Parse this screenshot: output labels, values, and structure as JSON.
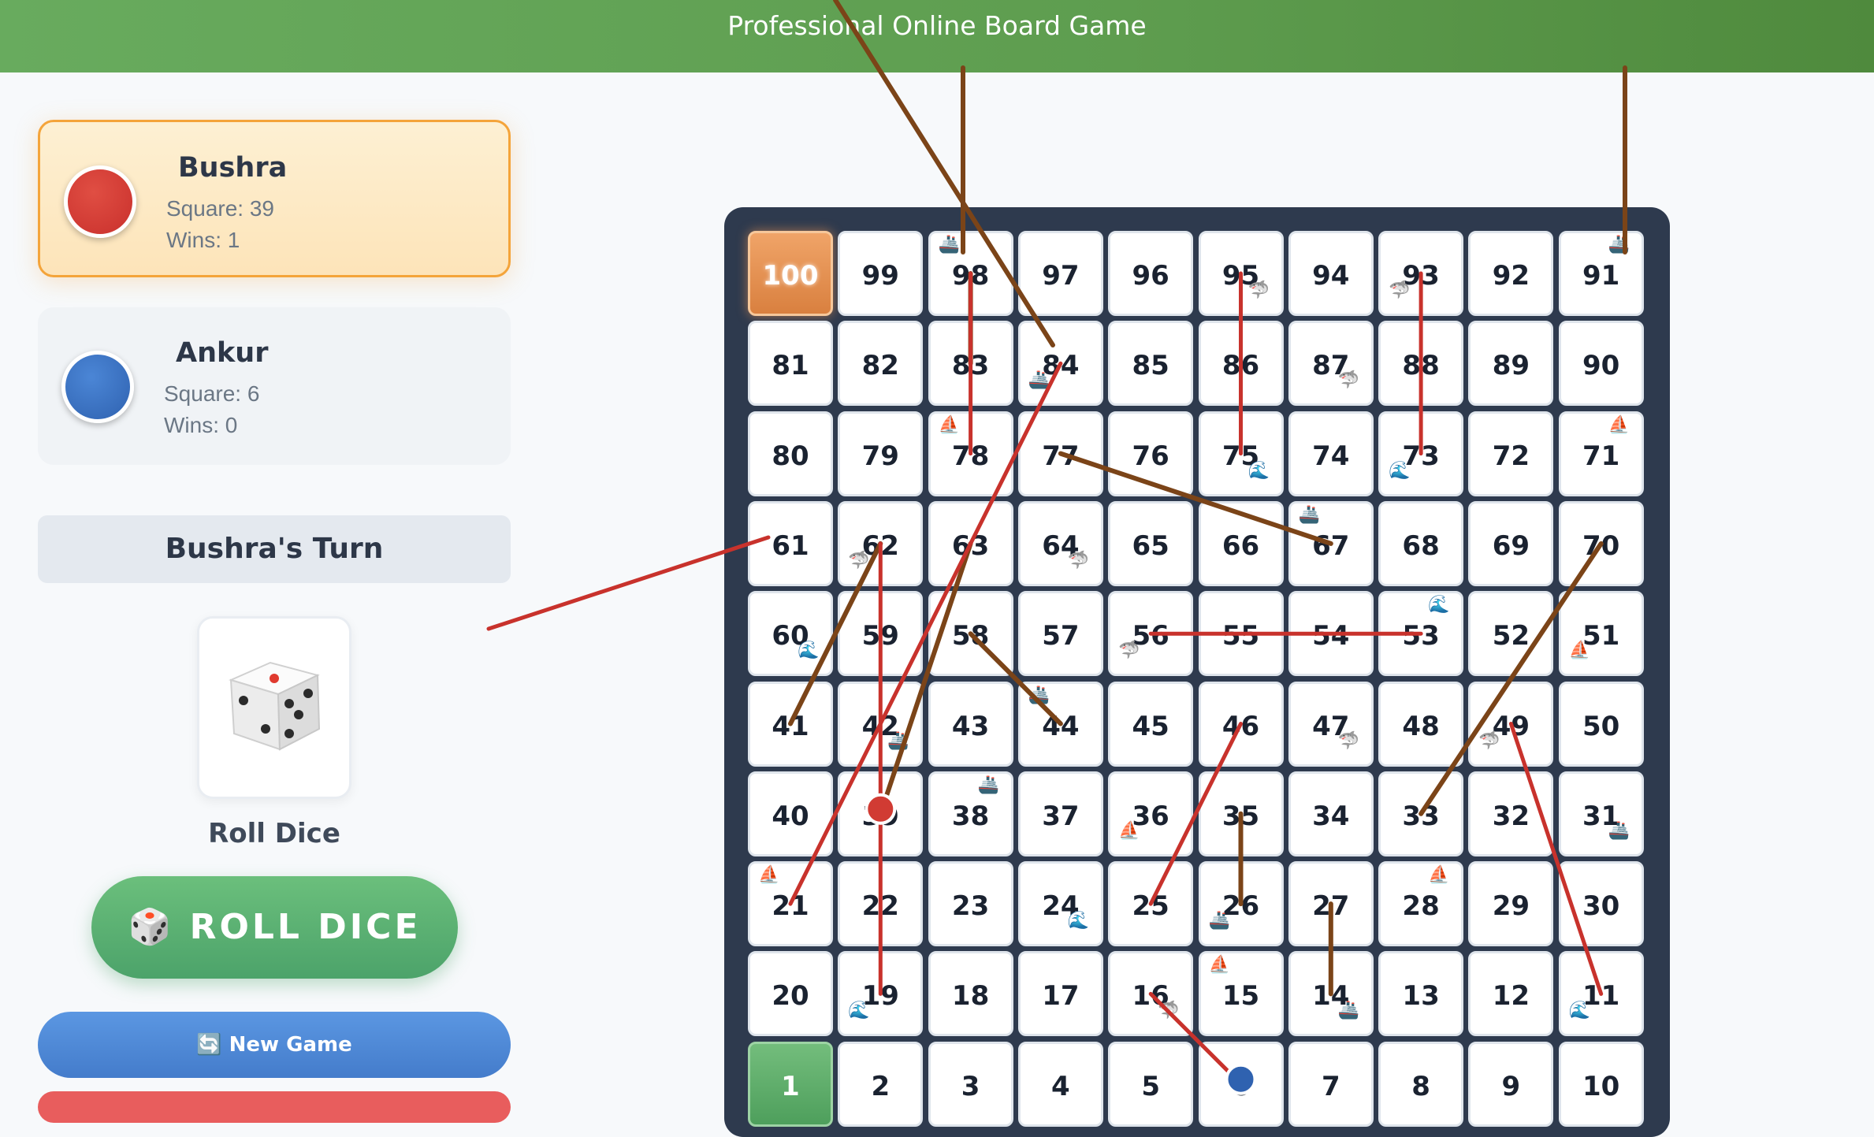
{
  "header": {
    "title": "Professional Online Board Game"
  },
  "players": [
    {
      "name": "Bushra",
      "square_text": "Square: 39",
      "wins_text": "Wins: 1",
      "color": "#d13b33",
      "active": true
    },
    {
      "name": "Ankur",
      "square_text": "Square: 6",
      "wins_text": "Wins: 0",
      "color": "#3a72c4",
      "active": false
    }
  ],
  "turn": {
    "label": "Bushra's Turn"
  },
  "dice": {
    "label": "Roll Dice",
    "face_icon": "die-five-icon"
  },
  "buttons": {
    "roll": "🎲 ROLL DICE",
    "new_game": "🔄 New Game"
  },
  "board": {
    "rows": [
      [
        100,
        99,
        98,
        97,
        96,
        95,
        94,
        93,
        92,
        91
      ],
      [
        81,
        82,
        83,
        84,
        85,
        86,
        87,
        88,
        89,
        90
      ],
      [
        80,
        79,
        78,
        77,
        76,
        75,
        74,
        73,
        72,
        71
      ],
      [
        61,
        62,
        63,
        64,
        65,
        66,
        67,
        68,
        69,
        70
      ],
      [
        60,
        59,
        58,
        57,
        56,
        55,
        54,
        53,
        52,
        51
      ],
      [
        41,
        42,
        43,
        44,
        45,
        46,
        47,
        48,
        49,
        50
      ],
      [
        40,
        39,
        38,
        37,
        36,
        35,
        34,
        33,
        32,
        31
      ],
      [
        21,
        22,
        23,
        24,
        25,
        26,
        27,
        28,
        29,
        30
      ],
      [
        20,
        19,
        18,
        17,
        16,
        15,
        14,
        13,
        12,
        11
      ],
      [
        1,
        2,
        3,
        4,
        5,
        6,
        7,
        8,
        9,
        10
      ]
    ],
    "finish_square": 100,
    "start_square": 1,
    "cell_icons": [
      {
        "square": 98,
        "icon": "🚢"
      },
      {
        "square": 95,
        "icon": "🦈"
      },
      {
        "square": 93,
        "icon": "🦈"
      },
      {
        "square": 91,
        "icon": "🚢"
      },
      {
        "square": 84,
        "icon": "🚢"
      },
      {
        "square": 87,
        "icon": "🦈"
      },
      {
        "square": 78,
        "icon": "⛵"
      },
      {
        "square": 75,
        "icon": "🌊"
      },
      {
        "square": 73,
        "icon": "🌊"
      },
      {
        "square": 71,
        "icon": "⛵"
      },
      {
        "square": 62,
        "icon": "🦈"
      },
      {
        "square": 64,
        "icon": "🦈"
      },
      {
        "square": 67,
        "icon": "🚢"
      },
      {
        "square": 60,
        "icon": "🌊"
      },
      {
        "square": 56,
        "icon": "🦈"
      },
      {
        "square": 53,
        "icon": "🌊"
      },
      {
        "square": 51,
        "icon": "⛵"
      },
      {
        "square": 42,
        "icon": "🚢"
      },
      {
        "square": 44,
        "icon": "🚢"
      },
      {
        "square": 47,
        "icon": "🦈"
      },
      {
        "square": 49,
        "icon": "🦈"
      },
      {
        "square": 38,
        "icon": "🚢"
      },
      {
        "square": 36,
        "icon": "⛵"
      },
      {
        "square": 31,
        "icon": "🚢"
      },
      {
        "square": 21,
        "icon": "⛵"
      },
      {
        "square": 24,
        "icon": "🌊"
      },
      {
        "square": 26,
        "icon": "🚢"
      },
      {
        "square": 28,
        "icon": "⛵"
      },
      {
        "square": 19,
        "icon": "🌊"
      },
      {
        "square": 16,
        "icon": "🦈"
      },
      {
        "square": 15,
        "icon": "⛵"
      },
      {
        "square": 14,
        "icon": "🚢"
      },
      {
        "square": 11,
        "icon": "🌊"
      }
    ],
    "ladders": [
      {
        "from": 26,
        "to": 35
      },
      {
        "from": 14,
        "to": 27
      },
      {
        "from": 44,
        "to": 58
      },
      {
        "from": 67,
        "to": 77
      },
      {
        "from": 41,
        "to": 62
      },
      {
        "from": 39,
        "to": 63
      },
      {
        "from": 33,
        "to": 70
      },
      {
        "from": 83,
        "to": 98
      }
    ],
    "snakes": [
      {
        "from": 98,
        "to": 78
      },
      {
        "from": 84,
        "to": 21
      },
      {
        "from": 62,
        "to": 19
      },
      {
        "from": 95,
        "to": 75
      },
      {
        "from": 93,
        "to": 73
      },
      {
        "from": 56,
        "to": 53
      },
      {
        "from": 46,
        "to": 25
      },
      {
        "from": 49,
        "to": 11
      },
      {
        "from": 16,
        "to": 6
      }
    ],
    "tokens": [
      {
        "player": "Bushra",
        "square": 39,
        "color": "#d13b33"
      },
      {
        "player": "Ankur",
        "square": 6,
        "color": "#2f62b0"
      }
    ]
  }
}
